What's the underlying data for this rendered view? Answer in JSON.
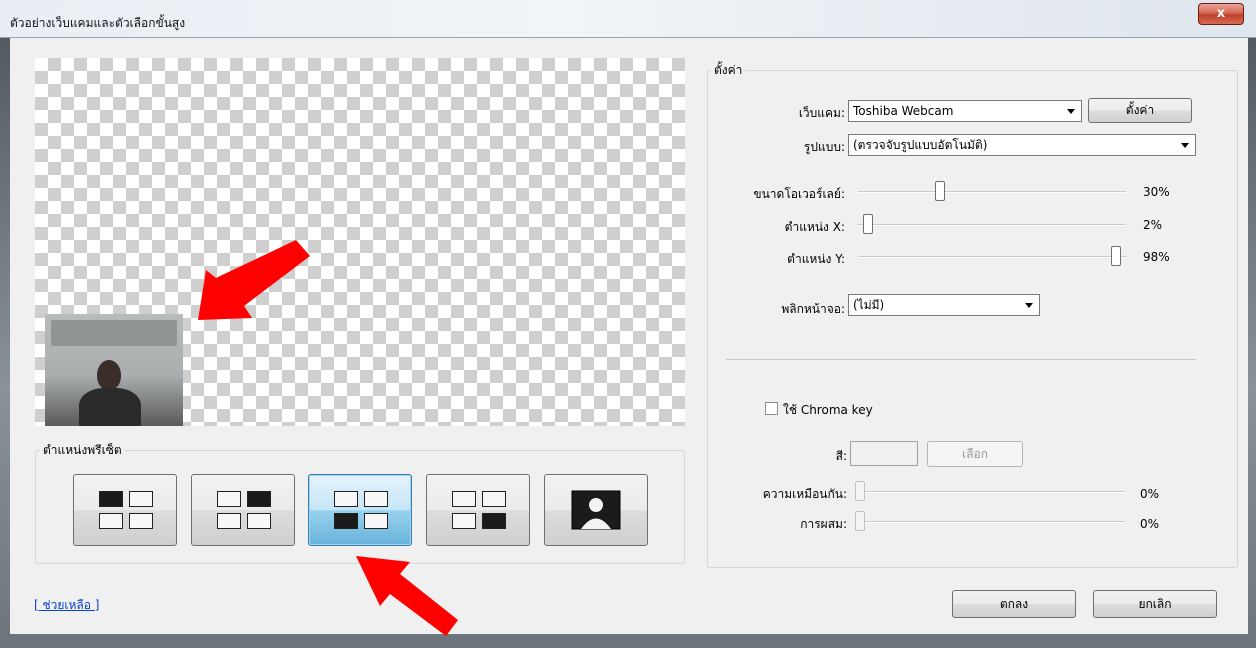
{
  "window": {
    "title": "ตัวอย่างเว็บแคมและตัวเลือกขั้นสูง",
    "close_label": "x"
  },
  "preview": {
    "presets_group_label": "ตำแหน่งพรีเซ็ต",
    "preset_buttons": [
      {
        "name": "top-left",
        "selected": false
      },
      {
        "name": "top-right",
        "selected": false
      },
      {
        "name": "bottom-left",
        "selected": true
      },
      {
        "name": "bottom-right",
        "selected": false
      },
      {
        "name": "fullscreen",
        "selected": false
      }
    ]
  },
  "settings": {
    "group_label": "ตั้งค่า",
    "webcam_label": "เว็บแคม:",
    "webcam_value": "Toshiba Webcam",
    "webcam_settings_button": "ตั้งค่า",
    "format_label": "รูปแบบ:",
    "format_value": "(ตรวจจับรูปแบบอัตโนมัติ)",
    "overlay_size_label": "ขนาดโอเวอร์เลย์:",
    "overlay_size_value": "30%",
    "overlay_size_level": 0.3,
    "pos_x_label": "ตำแหน่ง X:",
    "pos_x_value": "2%",
    "pos_x_level": 0.02,
    "pos_y_label": "ตำแหน่ง Y:",
    "pos_y_value": "98%",
    "pos_y_level": 0.98,
    "flip_label": "พลิกหน้าจอ:",
    "flip_value": "(ไม่มี)",
    "chroma_checkbox_label": "ใช้ Chroma key",
    "chroma_checked": false,
    "color_label": "สี:",
    "color_select_button": "เลือก",
    "similarity_label": "ความเหมือนกัน:",
    "similarity_value": "0%",
    "similarity_level": 0,
    "blend_label": "การผสม:",
    "blend_value": "0%",
    "blend_level": 0
  },
  "footer": {
    "help_link": "[ ช่วยเหลือ ]",
    "ok_button": "ตกลง",
    "cancel_button": "ยกเลิก"
  },
  "colors": {
    "annotation_arrow": "#ff0000",
    "selected_preset": "#98d1ef"
  }
}
